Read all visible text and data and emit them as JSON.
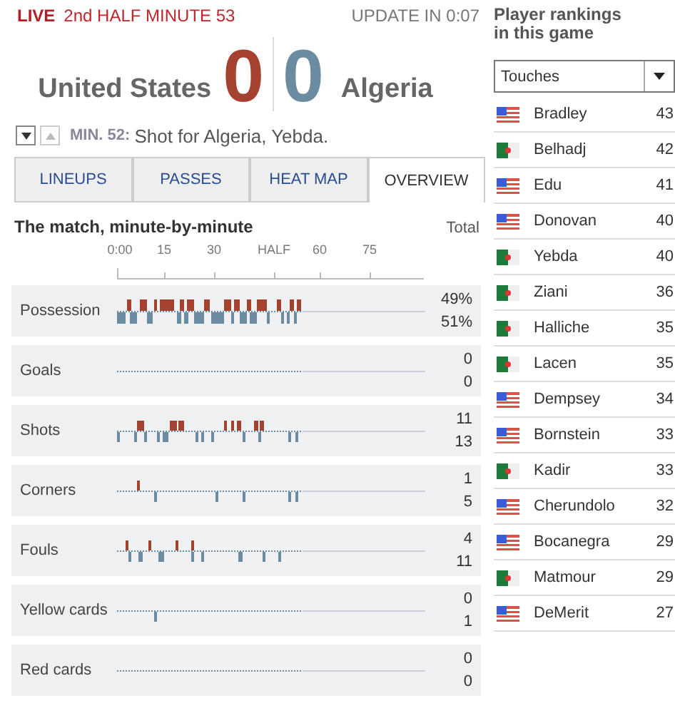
{
  "status": {
    "live": "LIVE",
    "period": "2nd HALF MINUTE 53",
    "update": "UPDATE IN 0:07"
  },
  "score": {
    "home": "United States",
    "home_goals": "0",
    "away_goals": "0",
    "away": "Algeria"
  },
  "commentary": {
    "minute_label": "MIN. 52:",
    "text": "Shot for Algeria, Yebda."
  },
  "tabs": [
    {
      "label": "LINEUPS",
      "selected": false
    },
    {
      "label": "PASSES",
      "selected": false
    },
    {
      "label": "HEAT MAP",
      "selected": false
    },
    {
      "label": "OVERVIEW",
      "selected": true
    }
  ],
  "timeline": {
    "title": "The match, minute-by-minute",
    "total_label": "Total",
    "ticks": [
      "0:00",
      "15",
      "30",
      "HALF",
      "60",
      "75"
    ],
    "rows": [
      {
        "kind": "possession",
        "label": "Possession",
        "home_total": "49%",
        "away_total": "51%"
      },
      {
        "kind": "goals",
        "label": "Goals",
        "home_total": "0",
        "away_total": "0"
      },
      {
        "kind": "shots",
        "label": "Shots",
        "home_total": "11",
        "away_total": "13"
      },
      {
        "kind": "corners",
        "label": "Corners",
        "home_total": "1",
        "away_total": "5"
      },
      {
        "kind": "fouls",
        "label": "Fouls",
        "home_total": "4",
        "away_total": "11"
      },
      {
        "kind": "yellow",
        "label": "Yellow cards",
        "home_total": "0",
        "away_total": "1"
      },
      {
        "kind": "red",
        "label": "Red cards",
        "home_total": "0",
        "away_total": "0"
      }
    ]
  },
  "rankings": {
    "title": "Player rankings in this game",
    "metric": "Touches",
    "players": [
      {
        "kind": "us",
        "name": "Bradley",
        "value": "43"
      },
      {
        "kind": "dz",
        "name": "Belhadj",
        "value": "42"
      },
      {
        "kind": "us",
        "name": "Edu",
        "value": "41"
      },
      {
        "kind": "us",
        "name": "Donovan",
        "value": "40"
      },
      {
        "kind": "dz",
        "name": "Yebda",
        "value": "40"
      },
      {
        "kind": "dz",
        "name": "Ziani",
        "value": "36"
      },
      {
        "kind": "dz",
        "name": "Halliche",
        "value": "35"
      },
      {
        "kind": "dz",
        "name": "Lacen",
        "value": "35"
      },
      {
        "kind": "us",
        "name": "Dempsey",
        "value": "34"
      },
      {
        "kind": "us",
        "name": "Bornstein",
        "value": "33"
      },
      {
        "kind": "dz",
        "name": "Kadir",
        "value": "33"
      },
      {
        "kind": "us",
        "name": "Cherundolo",
        "value": "32"
      },
      {
        "kind": "us",
        "name": "Bocanegra",
        "value": "29"
      },
      {
        "kind": "dz",
        "name": "Matmour",
        "value": "29"
      },
      {
        "kind": "us",
        "name": "DeMerit",
        "value": "27"
      }
    ]
  }
}
